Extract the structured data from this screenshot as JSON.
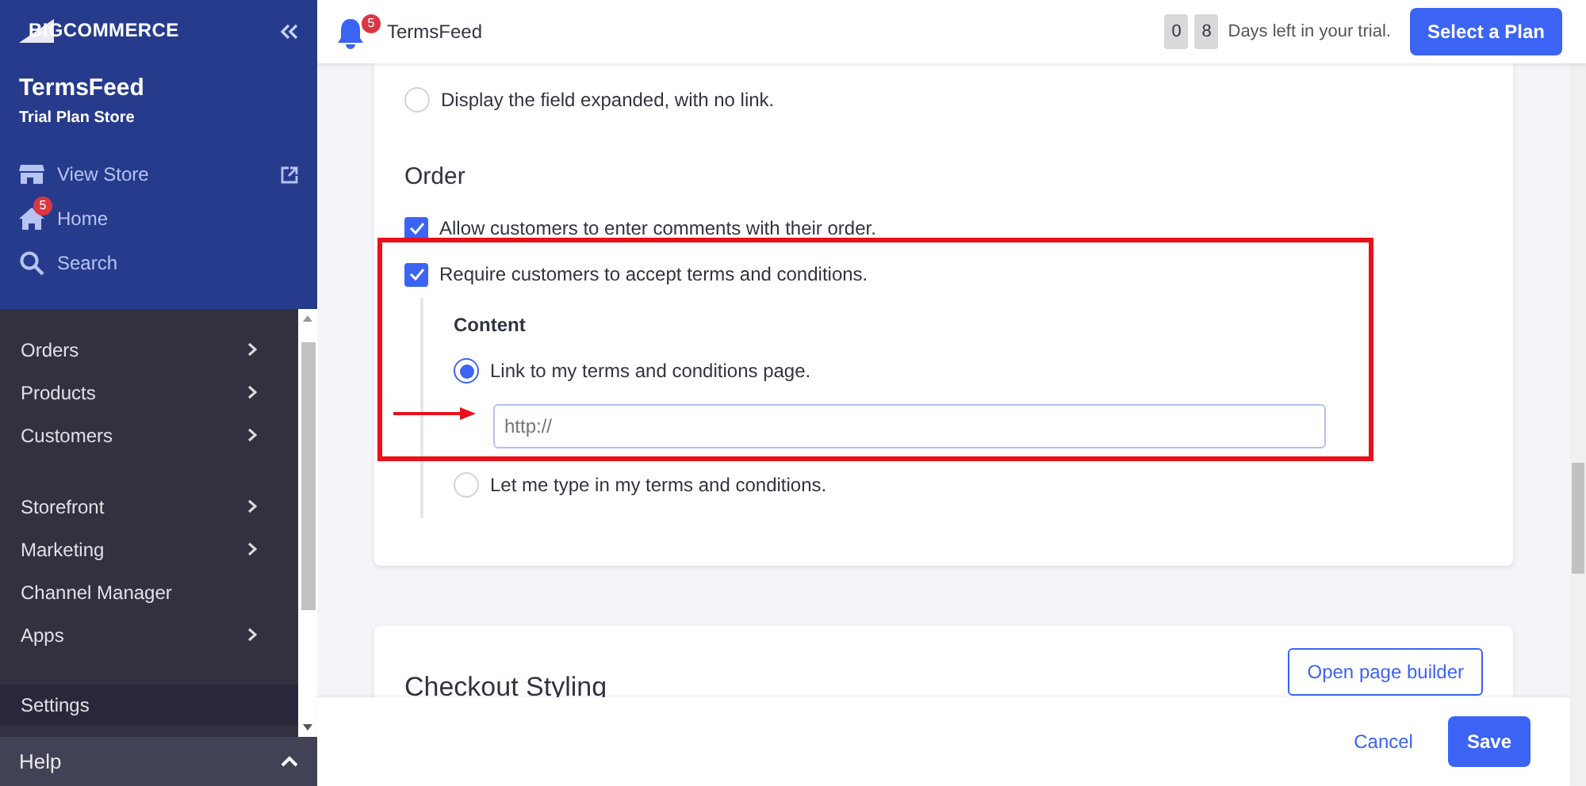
{
  "sidebar": {
    "logo": "BIGCOMMERCE",
    "store_name": "TermsFeed",
    "store_plan": "Trial Plan Store",
    "quick_links": [
      {
        "kind": "store",
        "label": "View Store",
        "external": true
      },
      {
        "kind": "home",
        "label": "Home",
        "badge": "5"
      },
      {
        "kind": "search",
        "label": "Search"
      }
    ],
    "nav_groups": [
      [
        {
          "label": "Orders",
          "expandable": true,
          "selected": false
        },
        {
          "label": "Products",
          "expandable": true,
          "selected": false
        },
        {
          "label": "Customers",
          "expandable": true,
          "selected": false
        }
      ],
      [
        {
          "label": "Storefront",
          "expandable": true,
          "selected": false
        },
        {
          "label": "Marketing",
          "expandable": true,
          "selected": false
        },
        {
          "label": "Channel Manager",
          "expandable": false,
          "selected": false
        },
        {
          "label": "Apps",
          "expandable": true,
          "selected": false
        }
      ],
      [
        {
          "label": "Settings",
          "expandable": false,
          "selected": true
        }
      ]
    ],
    "help": "Help"
  },
  "topbar": {
    "notification_badge": "5",
    "store_name": "TermsFeed",
    "trial_digits": [
      "0",
      "8"
    ],
    "trial_text": "Days left in your trial.",
    "plan_button": "Select a Plan"
  },
  "card": {
    "top_option": {
      "label": "Display the field expanded, with no link.",
      "selected": false
    },
    "section_title": "Order",
    "checkboxes": [
      {
        "label": "Allow customers to enter comments with their order.",
        "checked": true
      },
      {
        "label": "Require customers to accept terms and conditions.",
        "checked": true,
        "highlighted": true
      }
    ],
    "content_title": "Content",
    "content_options": [
      {
        "kind": "link",
        "label": "Link to my terms and conditions page.",
        "selected": true,
        "placeholder": "http://"
      },
      {
        "kind": "text",
        "label": "Let me type in my terms and conditions.",
        "selected": false
      }
    ]
  },
  "styling_card": {
    "title": "Checkout Styling",
    "button": "Open page builder"
  },
  "footer": {
    "cancel": "Cancel",
    "save": "Save"
  }
}
